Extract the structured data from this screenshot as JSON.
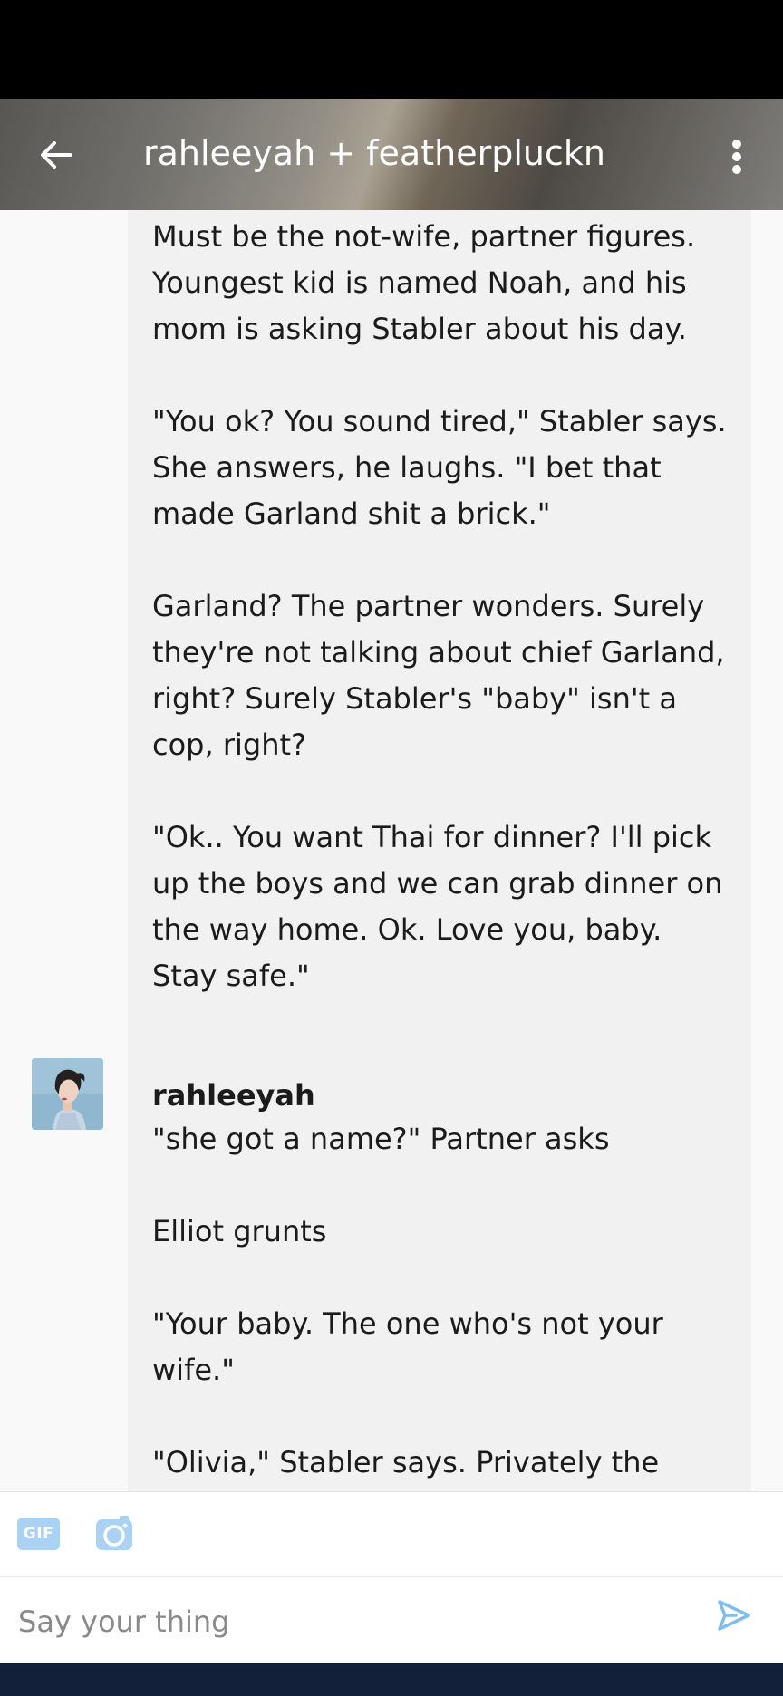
{
  "header": {
    "title": "rahleeyah + featherpluckn",
    "back_icon": "arrow-left-icon",
    "menu_icon": "more-vertical-icon"
  },
  "messages": [
    {
      "sender": "",
      "paragraphs": [
        "Must be the not-wife, partner figures. Youngest kid is named Noah, and his mom is asking Stabler about his day.",
        "\"You ok? You sound tired,\" Stabler says. She answers, he laughs. \"I bet that made Garland shit a brick.\"",
        "Garland? The partner wonders. Surely they're not talking about chief Garland, right? Surely Stabler's \"baby\" isn't a cop, right?",
        "\"Ok.. You want Thai for dinner? I'll pick up the boys and we can grab dinner on the way home. Ok. Love you, baby. Stay safe.\""
      ]
    },
    {
      "sender": "rahleeyah",
      "paragraphs": [
        "\"she got a name?\" Partner asks",
        "Elliot grunts",
        "\"Your baby. The one who's not your wife.\"",
        "\"Olivia,\" Stabler says. Privately the"
      ]
    }
  ],
  "composer": {
    "gif_label": "GIF",
    "camera_icon": "camera-icon",
    "placeholder": "Say your thing",
    "send_icon": "send-icon"
  },
  "colors": {
    "accent": "#7fbdf0",
    "bubble": "#f1f1f1",
    "nav_bar": "#13203a"
  }
}
